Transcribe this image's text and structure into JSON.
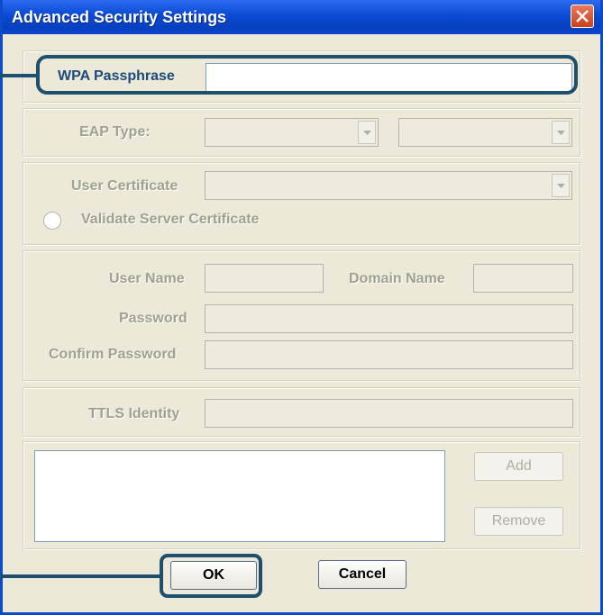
{
  "window": {
    "title": "Advanced Security Settings",
    "close_icon": "close-icon",
    "accent_color": "#0a4cc8",
    "callout_color": "#1f4f6e"
  },
  "passphrase": {
    "label": "WPA Passphrase",
    "value": ""
  },
  "eap": {
    "label": "EAP Type:",
    "type_value": "",
    "subtype_value": ""
  },
  "certificate": {
    "label": "User Certificate",
    "value": "",
    "validate_label": "Validate Server Certificate",
    "validate_checked": false
  },
  "credentials": {
    "username_label": "User Name",
    "domain_label": "Domain Name",
    "password_label": "Password",
    "confirm_label": "Confirm Password"
  },
  "ttls": {
    "label": "TTLS Identity",
    "value": ""
  },
  "list": {
    "items": [],
    "add_label": "Add",
    "remove_label": "Remove"
  },
  "buttons": {
    "ok_label": "OK",
    "cancel_label": "Cancel"
  }
}
